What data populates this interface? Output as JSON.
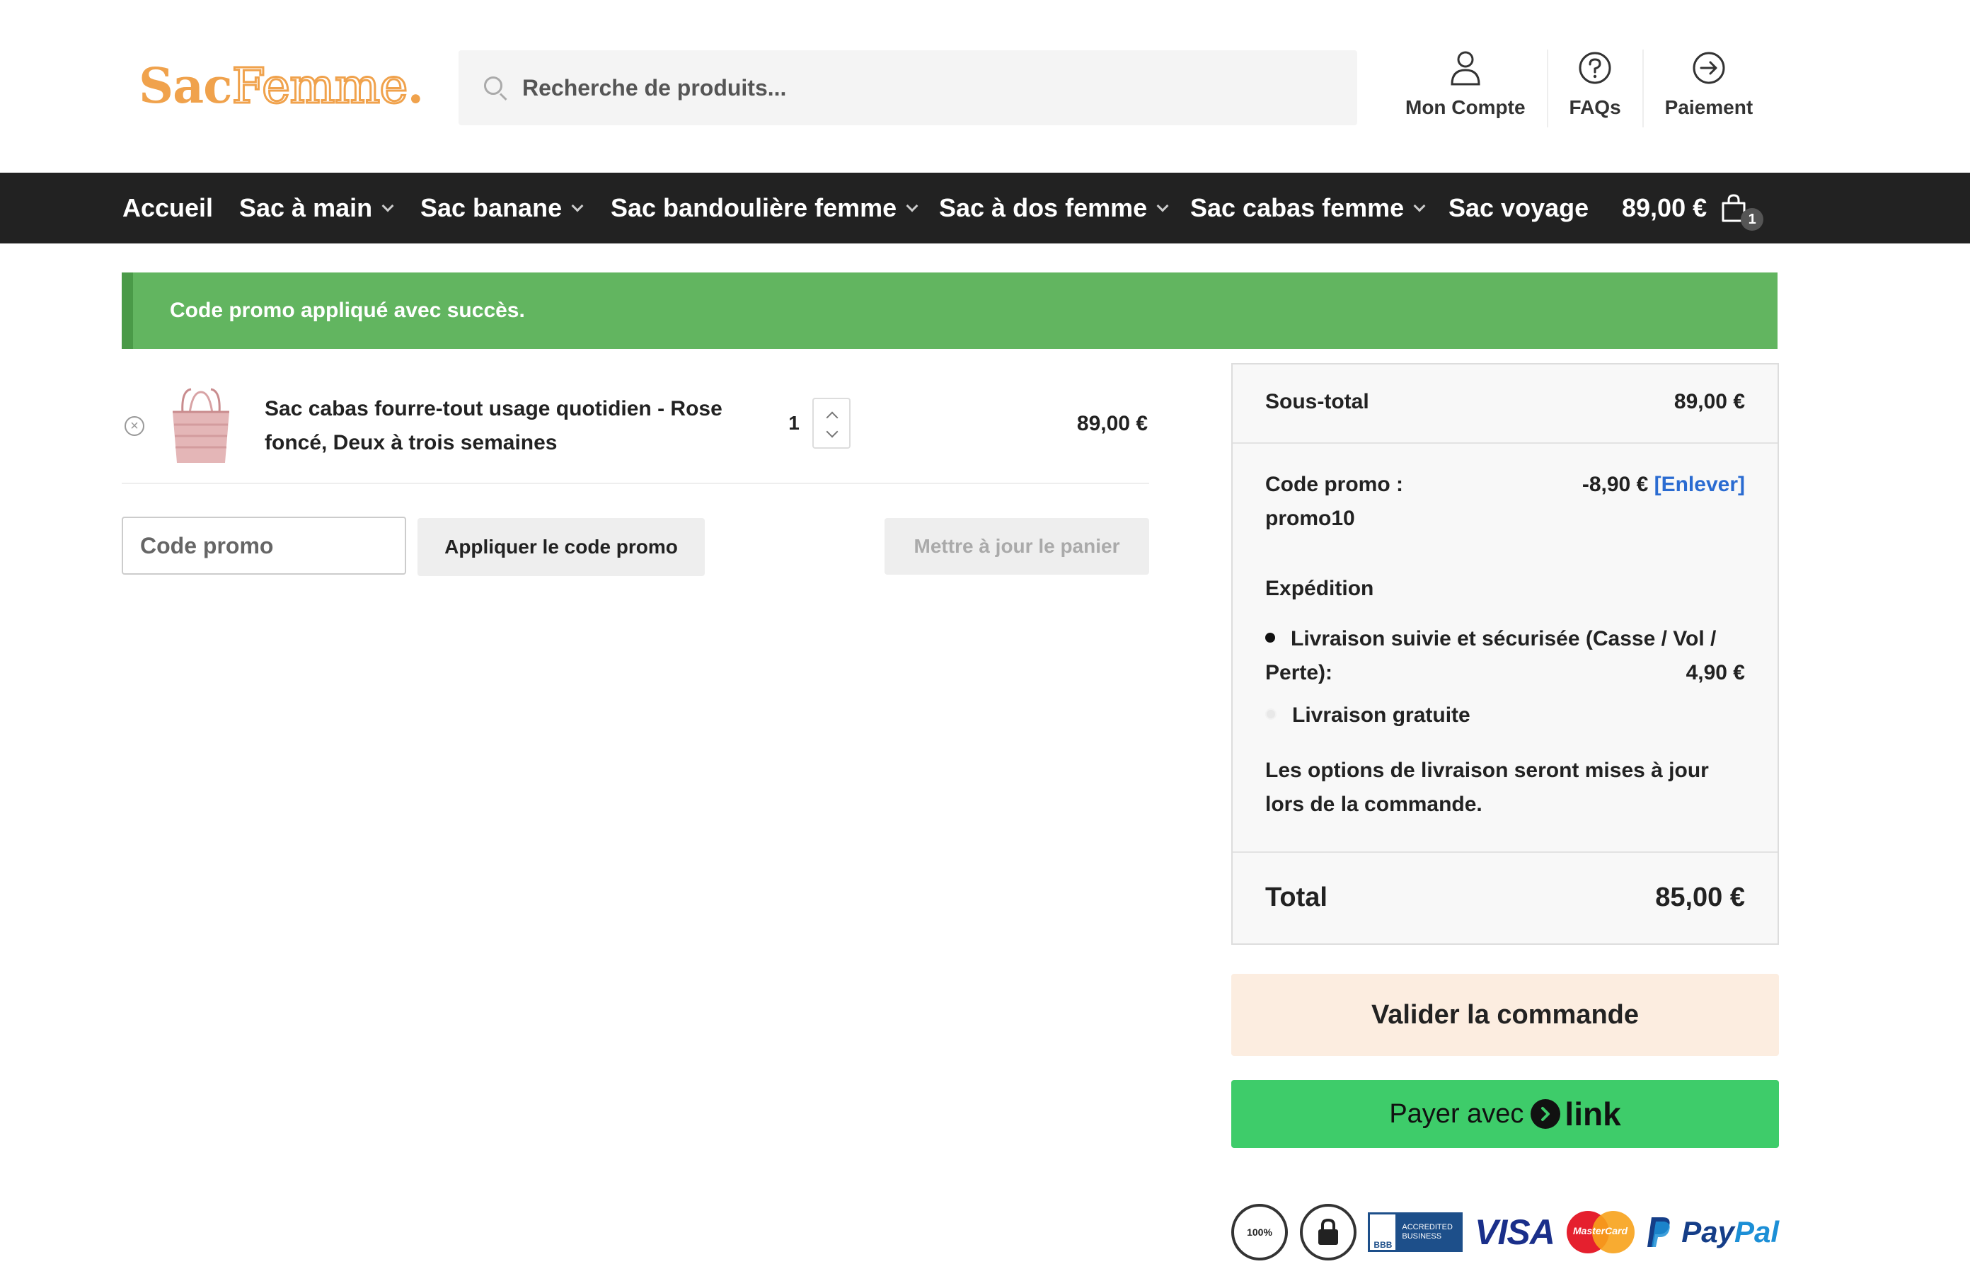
{
  "header": {
    "logo": {
      "part1": "Sac",
      "part2": "Femme",
      "part3": "."
    },
    "search_placeholder": "Recherche de produits...",
    "links": [
      {
        "label": "Mon Compte",
        "icon": "user-icon"
      },
      {
        "label": "FAQs",
        "icon": "help-circle-icon"
      },
      {
        "label": "Paiement",
        "icon": "arrow-circle-right-icon"
      }
    ]
  },
  "nav": {
    "items": [
      {
        "label": "Accueil",
        "has_dropdown": false
      },
      {
        "label": "Sac à main",
        "has_dropdown": true
      },
      {
        "label": "Sac banane",
        "has_dropdown": true
      },
      {
        "label": "Sac bandoulière femme",
        "has_dropdown": true
      },
      {
        "label": "Sac à dos femme",
        "has_dropdown": true
      },
      {
        "label": "Sac cabas femme",
        "has_dropdown": true
      },
      {
        "label": "Sac voyage",
        "has_dropdown": false
      }
    ],
    "cart_total": "89,00 €",
    "cart_count": "1"
  },
  "notice": "Code promo appliqué avec succès.",
  "cart": {
    "items": [
      {
        "name": "Sac cabas fourre-tout usage quotidien - Rose foncé, Deux à trois semaines",
        "quantity": "1",
        "price": "89,00 €",
        "remove_symbol": "×"
      }
    ],
    "coupon_placeholder": "Code promo",
    "apply_label": "Appliquer le code promo",
    "update_label": "Mettre à jour le panier"
  },
  "totals": {
    "subtotal_label": "Sous-total",
    "subtotal_value": "89,00 €",
    "coupon_label": "Code promo :",
    "coupon_code": "promo10",
    "coupon_value": "-8,90 €",
    "coupon_remove": "[Enlever]",
    "shipping_label": "Expédition",
    "shipping_options": [
      {
        "label": "Livraison suivie et sécurisée (Casse / Vol / Perte):",
        "price": "4,90 €",
        "selected": true
      },
      {
        "label": "Livraison gratuite",
        "price": "",
        "selected": false
      }
    ],
    "shipping_note": "Les options de livraison seront mises à jour lors de la commande.",
    "total_label": "Total",
    "total_value": "85,00 €"
  },
  "checkout": {
    "validate_label": "Valider la commande",
    "link_pay_prefix": "Payer avec",
    "link_brand": "link"
  },
  "trust": {
    "satisfaction": "100%",
    "bbb_left": "BBB",
    "bbb_right_1": "ACCREDITED",
    "bbb_right_2": "BUSINESS",
    "visa": "VISA",
    "mastercard": "MasterCard",
    "paypal_1": "Pay",
    "paypal_2": "Pal"
  },
  "colors": {
    "accent_orange": "#f0a24c",
    "nav_bg": "#222222",
    "notice_green": "#62b560",
    "link_green": "#3ecc6a",
    "checkout_peach": "#fcede0",
    "link_blue": "#2a6bd1"
  }
}
